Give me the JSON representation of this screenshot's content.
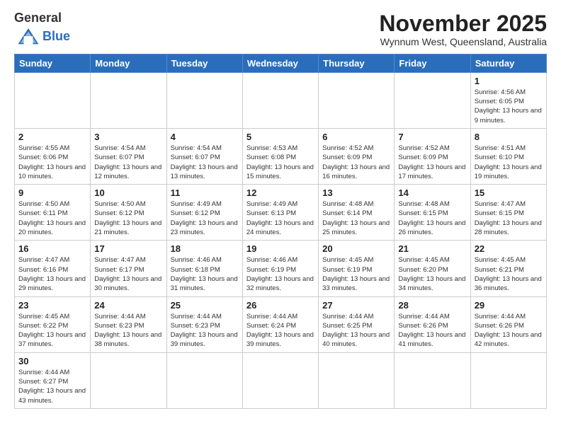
{
  "header": {
    "logo_general": "General",
    "logo_blue": "Blue",
    "month_title": "November 2025",
    "location": "Wynnum West, Queensland, Australia"
  },
  "days_of_week": [
    "Sunday",
    "Monday",
    "Tuesday",
    "Wednesday",
    "Thursday",
    "Friday",
    "Saturday"
  ],
  "weeks": [
    [
      {
        "day": "",
        "info": ""
      },
      {
        "day": "",
        "info": ""
      },
      {
        "day": "",
        "info": ""
      },
      {
        "day": "",
        "info": ""
      },
      {
        "day": "",
        "info": ""
      },
      {
        "day": "",
        "info": ""
      },
      {
        "day": "1",
        "info": "Sunrise: 4:56 AM\nSunset: 6:05 PM\nDaylight: 13 hours and 9 minutes."
      }
    ],
    [
      {
        "day": "2",
        "info": "Sunrise: 4:55 AM\nSunset: 6:06 PM\nDaylight: 13 hours and 10 minutes."
      },
      {
        "day": "3",
        "info": "Sunrise: 4:54 AM\nSunset: 6:07 PM\nDaylight: 13 hours and 12 minutes."
      },
      {
        "day": "4",
        "info": "Sunrise: 4:54 AM\nSunset: 6:07 PM\nDaylight: 13 hours and 13 minutes."
      },
      {
        "day": "5",
        "info": "Sunrise: 4:53 AM\nSunset: 6:08 PM\nDaylight: 13 hours and 15 minutes."
      },
      {
        "day": "6",
        "info": "Sunrise: 4:52 AM\nSunset: 6:09 PM\nDaylight: 13 hours and 16 minutes."
      },
      {
        "day": "7",
        "info": "Sunrise: 4:52 AM\nSunset: 6:09 PM\nDaylight: 13 hours and 17 minutes."
      },
      {
        "day": "8",
        "info": "Sunrise: 4:51 AM\nSunset: 6:10 PM\nDaylight: 13 hours and 19 minutes."
      }
    ],
    [
      {
        "day": "9",
        "info": "Sunrise: 4:50 AM\nSunset: 6:11 PM\nDaylight: 13 hours and 20 minutes."
      },
      {
        "day": "10",
        "info": "Sunrise: 4:50 AM\nSunset: 6:12 PM\nDaylight: 13 hours and 21 minutes."
      },
      {
        "day": "11",
        "info": "Sunrise: 4:49 AM\nSunset: 6:12 PM\nDaylight: 13 hours and 23 minutes."
      },
      {
        "day": "12",
        "info": "Sunrise: 4:49 AM\nSunset: 6:13 PM\nDaylight: 13 hours and 24 minutes."
      },
      {
        "day": "13",
        "info": "Sunrise: 4:48 AM\nSunset: 6:14 PM\nDaylight: 13 hours and 25 minutes."
      },
      {
        "day": "14",
        "info": "Sunrise: 4:48 AM\nSunset: 6:15 PM\nDaylight: 13 hours and 26 minutes."
      },
      {
        "day": "15",
        "info": "Sunrise: 4:47 AM\nSunset: 6:15 PM\nDaylight: 13 hours and 28 minutes."
      }
    ],
    [
      {
        "day": "16",
        "info": "Sunrise: 4:47 AM\nSunset: 6:16 PM\nDaylight: 13 hours and 29 minutes."
      },
      {
        "day": "17",
        "info": "Sunrise: 4:47 AM\nSunset: 6:17 PM\nDaylight: 13 hours and 30 minutes."
      },
      {
        "day": "18",
        "info": "Sunrise: 4:46 AM\nSunset: 6:18 PM\nDaylight: 13 hours and 31 minutes."
      },
      {
        "day": "19",
        "info": "Sunrise: 4:46 AM\nSunset: 6:19 PM\nDaylight: 13 hours and 32 minutes."
      },
      {
        "day": "20",
        "info": "Sunrise: 4:45 AM\nSunset: 6:19 PM\nDaylight: 13 hours and 33 minutes."
      },
      {
        "day": "21",
        "info": "Sunrise: 4:45 AM\nSunset: 6:20 PM\nDaylight: 13 hours and 34 minutes."
      },
      {
        "day": "22",
        "info": "Sunrise: 4:45 AM\nSunset: 6:21 PM\nDaylight: 13 hours and 36 minutes."
      }
    ],
    [
      {
        "day": "23",
        "info": "Sunrise: 4:45 AM\nSunset: 6:22 PM\nDaylight: 13 hours and 37 minutes."
      },
      {
        "day": "24",
        "info": "Sunrise: 4:44 AM\nSunset: 6:23 PM\nDaylight: 13 hours and 38 minutes."
      },
      {
        "day": "25",
        "info": "Sunrise: 4:44 AM\nSunset: 6:23 PM\nDaylight: 13 hours and 39 minutes."
      },
      {
        "day": "26",
        "info": "Sunrise: 4:44 AM\nSunset: 6:24 PM\nDaylight: 13 hours and 39 minutes."
      },
      {
        "day": "27",
        "info": "Sunrise: 4:44 AM\nSunset: 6:25 PM\nDaylight: 13 hours and 40 minutes."
      },
      {
        "day": "28",
        "info": "Sunrise: 4:44 AM\nSunset: 6:26 PM\nDaylight: 13 hours and 41 minutes."
      },
      {
        "day": "29",
        "info": "Sunrise: 4:44 AM\nSunset: 6:26 PM\nDaylight: 13 hours and 42 minutes."
      }
    ],
    [
      {
        "day": "30",
        "info": "Sunrise: 4:44 AM\nSunset: 6:27 PM\nDaylight: 13 hours and 43 minutes."
      },
      {
        "day": "",
        "info": ""
      },
      {
        "day": "",
        "info": ""
      },
      {
        "day": "",
        "info": ""
      },
      {
        "day": "",
        "info": ""
      },
      {
        "day": "",
        "info": ""
      },
      {
        "day": "",
        "info": ""
      }
    ]
  ]
}
